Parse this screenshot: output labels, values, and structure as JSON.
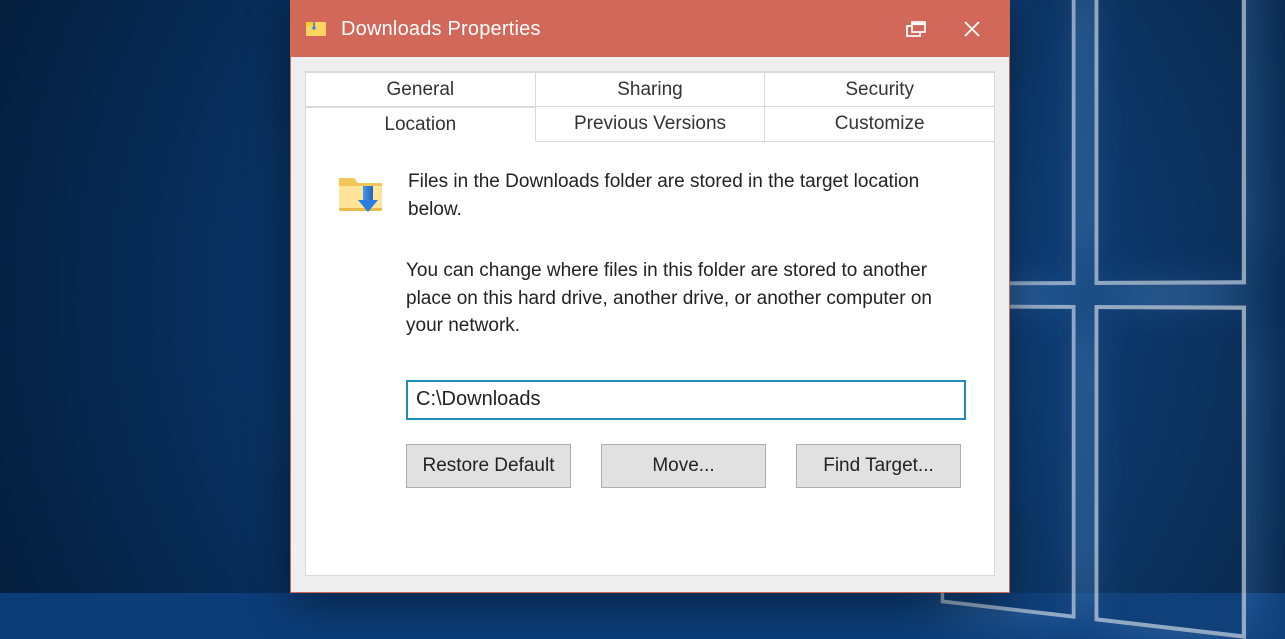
{
  "window": {
    "title": "Downloads Properties"
  },
  "tabs": {
    "row1": [
      "General",
      "Sharing",
      "Security"
    ],
    "row2": [
      "Location",
      "Previous Versions",
      "Customize"
    ],
    "active": "Location"
  },
  "location": {
    "intro": "Files in the Downloads folder are stored in the target location below.",
    "explain": "You can change where files in this folder are stored to another place on this hard drive, another drive, or another computer on your network.",
    "path": "C:\\Downloads",
    "buttons": {
      "restore": "Restore Default",
      "move": "Move...",
      "find": "Find Target..."
    }
  }
}
